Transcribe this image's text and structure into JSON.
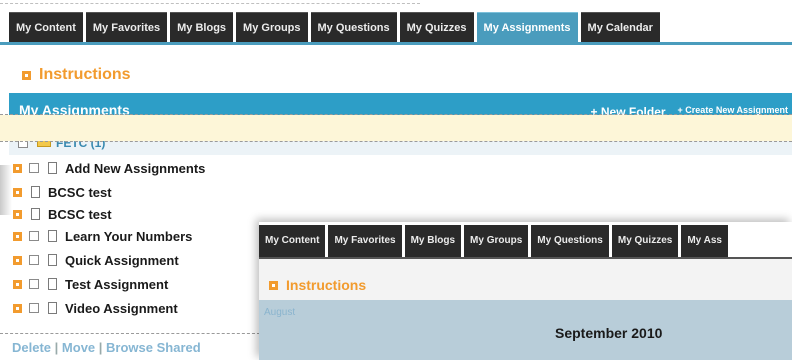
{
  "tabs": [
    {
      "label": "My Content",
      "active": false
    },
    {
      "label": "My Favorites",
      "active": false
    },
    {
      "label": "My Blogs",
      "active": false
    },
    {
      "label": "My Groups",
      "active": false
    },
    {
      "label": "My Questions",
      "active": false
    },
    {
      "label": "My Quizzes",
      "active": false
    },
    {
      "label": "My Assignments",
      "active": true
    },
    {
      "label": "My Calendar",
      "active": false
    }
  ],
  "instructions_label": "Instructions",
  "assignments_panel": {
    "title": "My Assignments",
    "new_folder": "+ New Folder",
    "create_new_assignment": "+ Create New Assignment"
  },
  "folder": {
    "label": "FETC (1)"
  },
  "items": [
    {
      "label": "Add New Assignments",
      "expand": true,
      "checkbox": true,
      "doc": true
    },
    {
      "label": "BCSC test",
      "expand": true,
      "checkbox": false,
      "doc": true
    },
    {
      "label": "BCSC test",
      "expand": true,
      "checkbox": false,
      "doc": true
    },
    {
      "label": "Learn Your Numbers",
      "expand": true,
      "checkbox": true,
      "doc": true
    },
    {
      "label": "Quick Assignment",
      "expand": true,
      "checkbox": true,
      "doc": true
    },
    {
      "label": "Test Assignment",
      "expand": true,
      "checkbox": true,
      "doc": true
    },
    {
      "label": "Video Assignment",
      "expand": true,
      "checkbox": true,
      "doc": true
    }
  ],
  "bottom_actions": {
    "delete": "Delete",
    "move": "Move",
    "browse_shared": "Browse Shared",
    "separator": "|"
  },
  "overlay": {
    "tabs": [
      "My Content",
      "My Favorites",
      "My Blogs",
      "My Groups",
      "My Questions",
      "My Quizzes",
      "My Ass"
    ],
    "instructions_label": "Instructions",
    "calendar_small_month": "August",
    "calendar_title": "September  2010"
  },
  "colors": {
    "accent_blue": "#2d9ec7",
    "active_tab": "#4a9cbd",
    "orange": "#f29b2e",
    "tab_dark": "#2a2a2a"
  }
}
